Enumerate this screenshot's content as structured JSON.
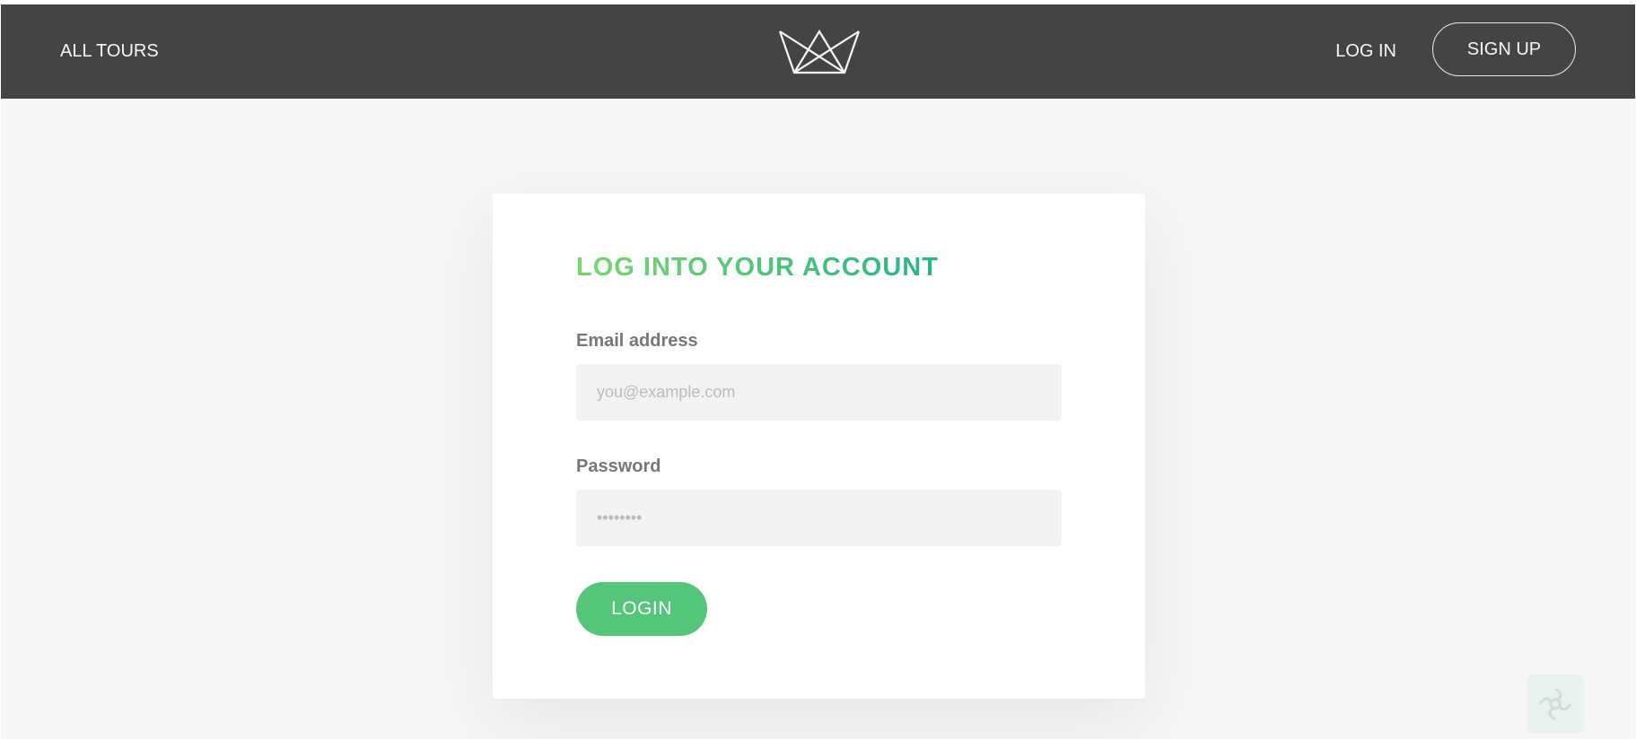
{
  "header": {
    "all_tours_label": "ALL TOURS",
    "login_label": "LOG IN",
    "signup_label": "SIGN UP"
  },
  "login_form": {
    "title": "LOG INTO YOUR ACCOUNT",
    "email_label": "Email address",
    "email_placeholder": "you@example.com",
    "password_label": "Password",
    "password_placeholder": "••••••••",
    "submit_label": "LOGIN"
  },
  "icons": {
    "logo": "crown-logo-icon",
    "corner_badge": "flower-badge-icon"
  },
  "colors": {
    "header_bg": "#444444",
    "page_bg": "#f6f6f6",
    "accent_green": "#55c57a",
    "title_gradient_start": "#7dd56f",
    "title_gradient_end": "#28b487"
  }
}
